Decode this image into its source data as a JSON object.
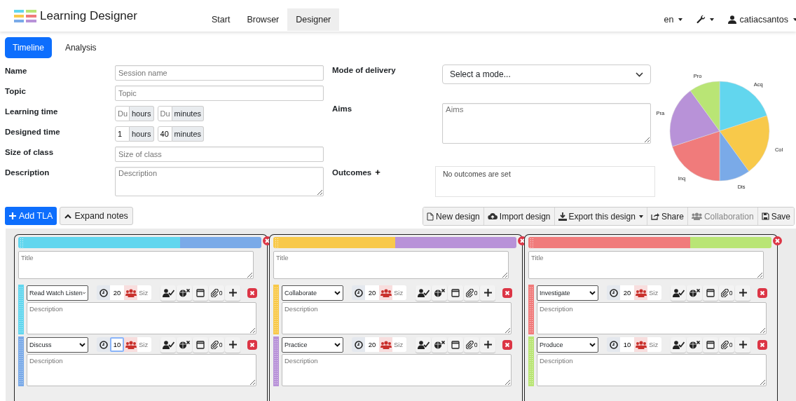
{
  "app": {
    "title": "Learning Designer"
  },
  "nav": [
    {
      "label": "Start",
      "selected": false
    },
    {
      "label": "Browser",
      "selected": false
    },
    {
      "label": "Designer",
      "selected": true
    }
  ],
  "header_right": {
    "language": "en",
    "user": "catiacsantos"
  },
  "tabs": [
    {
      "label": "Timeline",
      "selected": true
    },
    {
      "label": "Analysis",
      "selected": false
    }
  ],
  "form": [
    {
      "kind": "text",
      "label": "Name",
      "placeholder": "Session name"
    },
    {
      "kind": "text",
      "label": "Topic",
      "placeholder": "Topic"
    },
    {
      "kind": "duration",
      "label": "Learning time",
      "hours": {
        "placeholder": "Du",
        "unit": "hours"
      },
      "minutes": {
        "placeholder": "Du",
        "unit": "minutes"
      }
    },
    {
      "kind": "duration",
      "label": "Designed time",
      "hours": {
        "value": "1",
        "unit": "hours"
      },
      "minutes": {
        "value": "40",
        "unit": "minutes"
      }
    },
    {
      "kind": "text",
      "label": "Size of class",
      "placeholder": "Size of class"
    },
    {
      "kind": "textarea",
      "label": "Description",
      "placeholder": "Description"
    }
  ],
  "delivery": {
    "label": "Mode of delivery",
    "value": "Select a mode..."
  },
  "aims": {
    "label": "Aims",
    "placeholder": "Aims"
  },
  "outcomes": {
    "label": "Outcomes",
    "add": "+",
    "empty_text": "No outcomes are set"
  },
  "chart": {
    "chart_data": {
      "type": "pie",
      "categories": [
        "Acq",
        "Col",
        "Dis",
        "Inq",
        "Pra",
        "Pro"
      ],
      "values": [
        20,
        20,
        10,
        20,
        20,
        10
      ],
      "colors": [
        "#62d6ee",
        "#f8c94a",
        "#7aaae8",
        "#f07b7b",
        "#b892d8",
        "#b9e575"
      ]
    }
  },
  "toolbar_left": [
    {
      "label": "Add TLA",
      "primary": true
    },
    {
      "label": "Expand notes",
      "primary": false
    }
  ],
  "toolbar_right": [
    {
      "label": "New design",
      "dropdown": false,
      "disabled": false
    },
    {
      "label": "Import design",
      "dropdown": false,
      "disabled": false
    },
    {
      "label": "Export this design",
      "dropdown": true,
      "disabled": false
    },
    {
      "label": "Share",
      "dropdown": false,
      "disabled": false
    },
    {
      "label": "Collaboration",
      "dropdown": false,
      "disabled": true
    },
    {
      "label": "Save",
      "dropdown": false,
      "disabled": false
    }
  ],
  "tlas": [
    {
      "title_placeholder": "Title",
      "activities": [
        {
          "type": "Read Watch Listen",
          "color": "#62d6ee",
          "duration": "20",
          "focused": false,
          "size_placeholder": "Siz",
          "attachments": "0",
          "description_placeholder": "Description"
        },
        {
          "type": "Discuss",
          "color": "#7aaae8",
          "duration": "10",
          "focused": true,
          "size_placeholder": "Siz",
          "attachments": "0",
          "description_placeholder": "Description"
        }
      ]
    },
    {
      "title_placeholder": "Title",
      "activities": [
        {
          "type": "Collaborate",
          "color": "#f8c94a",
          "duration": "20",
          "focused": false,
          "size_placeholder": "Siz",
          "attachments": "0",
          "description_placeholder": "Description"
        },
        {
          "type": "Practice",
          "color": "#b892d8",
          "duration": "20",
          "focused": false,
          "size_placeholder": "Siz",
          "attachments": "0",
          "description_placeholder": "Description"
        }
      ]
    },
    {
      "title_placeholder": "Title",
      "activities": [
        {
          "type": "Investigate",
          "color": "#f07b7b",
          "duration": "20",
          "focused": false,
          "size_placeholder": "Siz",
          "attachments": "0",
          "description_placeholder": "Description"
        },
        {
          "type": "Produce",
          "color": "#b9e575",
          "duration": "10",
          "focused": false,
          "size_placeholder": "Siz",
          "attachments": "0",
          "description_placeholder": "Description"
        }
      ]
    }
  ]
}
